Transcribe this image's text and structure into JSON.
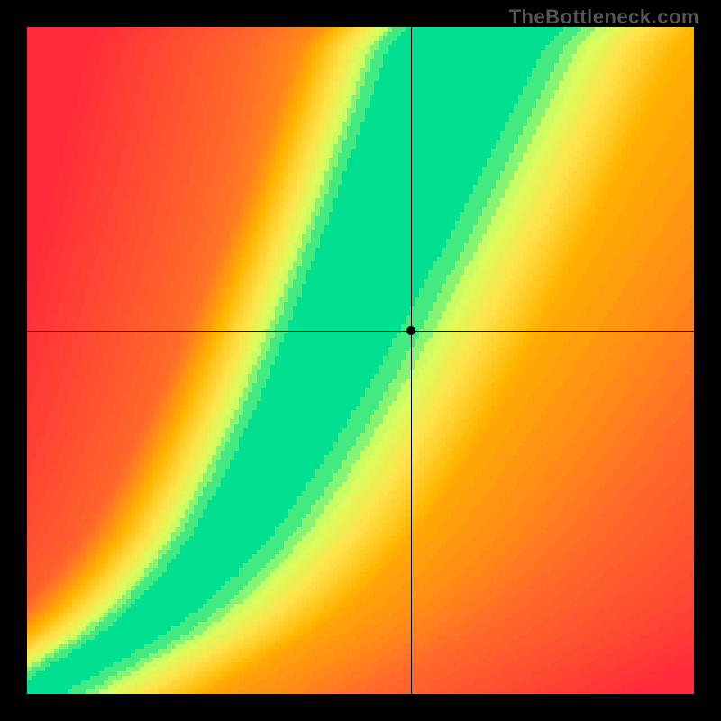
{
  "watermark": "TheBottleneck.com",
  "chart_data": {
    "type": "heatmap",
    "title": "",
    "xlabel": "",
    "ylabel": "",
    "xlim": [
      0,
      1
    ],
    "ylim": [
      0,
      1
    ],
    "grid": false,
    "legend": false,
    "color_scale": {
      "stops": [
        {
          "t": 0.0,
          "color": "#ff2a3a"
        },
        {
          "t": 0.35,
          "color": "#ff6a2a"
        },
        {
          "t": 0.6,
          "color": "#ffb400"
        },
        {
          "t": 0.8,
          "color": "#ffe24a"
        },
        {
          "t": 0.92,
          "color": "#d7ff60"
        },
        {
          "t": 1.0,
          "color": "#00e090"
        }
      ]
    },
    "ridge": {
      "points": [
        {
          "x": 0.0,
          "y": 0.0
        },
        {
          "x": 0.05,
          "y": 0.03
        },
        {
          "x": 0.1,
          "y": 0.06
        },
        {
          "x": 0.15,
          "y": 0.09
        },
        {
          "x": 0.2,
          "y": 0.13
        },
        {
          "x": 0.25,
          "y": 0.18
        },
        {
          "x": 0.3,
          "y": 0.24
        },
        {
          "x": 0.35,
          "y": 0.32
        },
        {
          "x": 0.4,
          "y": 0.41
        },
        {
          "x": 0.45,
          "y": 0.51
        },
        {
          "x": 0.5,
          "y": 0.62
        },
        {
          "x": 0.55,
          "y": 0.73
        },
        {
          "x": 0.6,
          "y": 0.85
        },
        {
          "x": 0.65,
          "y": 0.97
        },
        {
          "x": 0.68,
          "y": 1.0
        }
      ],
      "width_start": 0.025,
      "width_end": 0.1
    },
    "crosshair": {
      "x": 0.575,
      "y": 0.545
    },
    "resolution": 148
  }
}
